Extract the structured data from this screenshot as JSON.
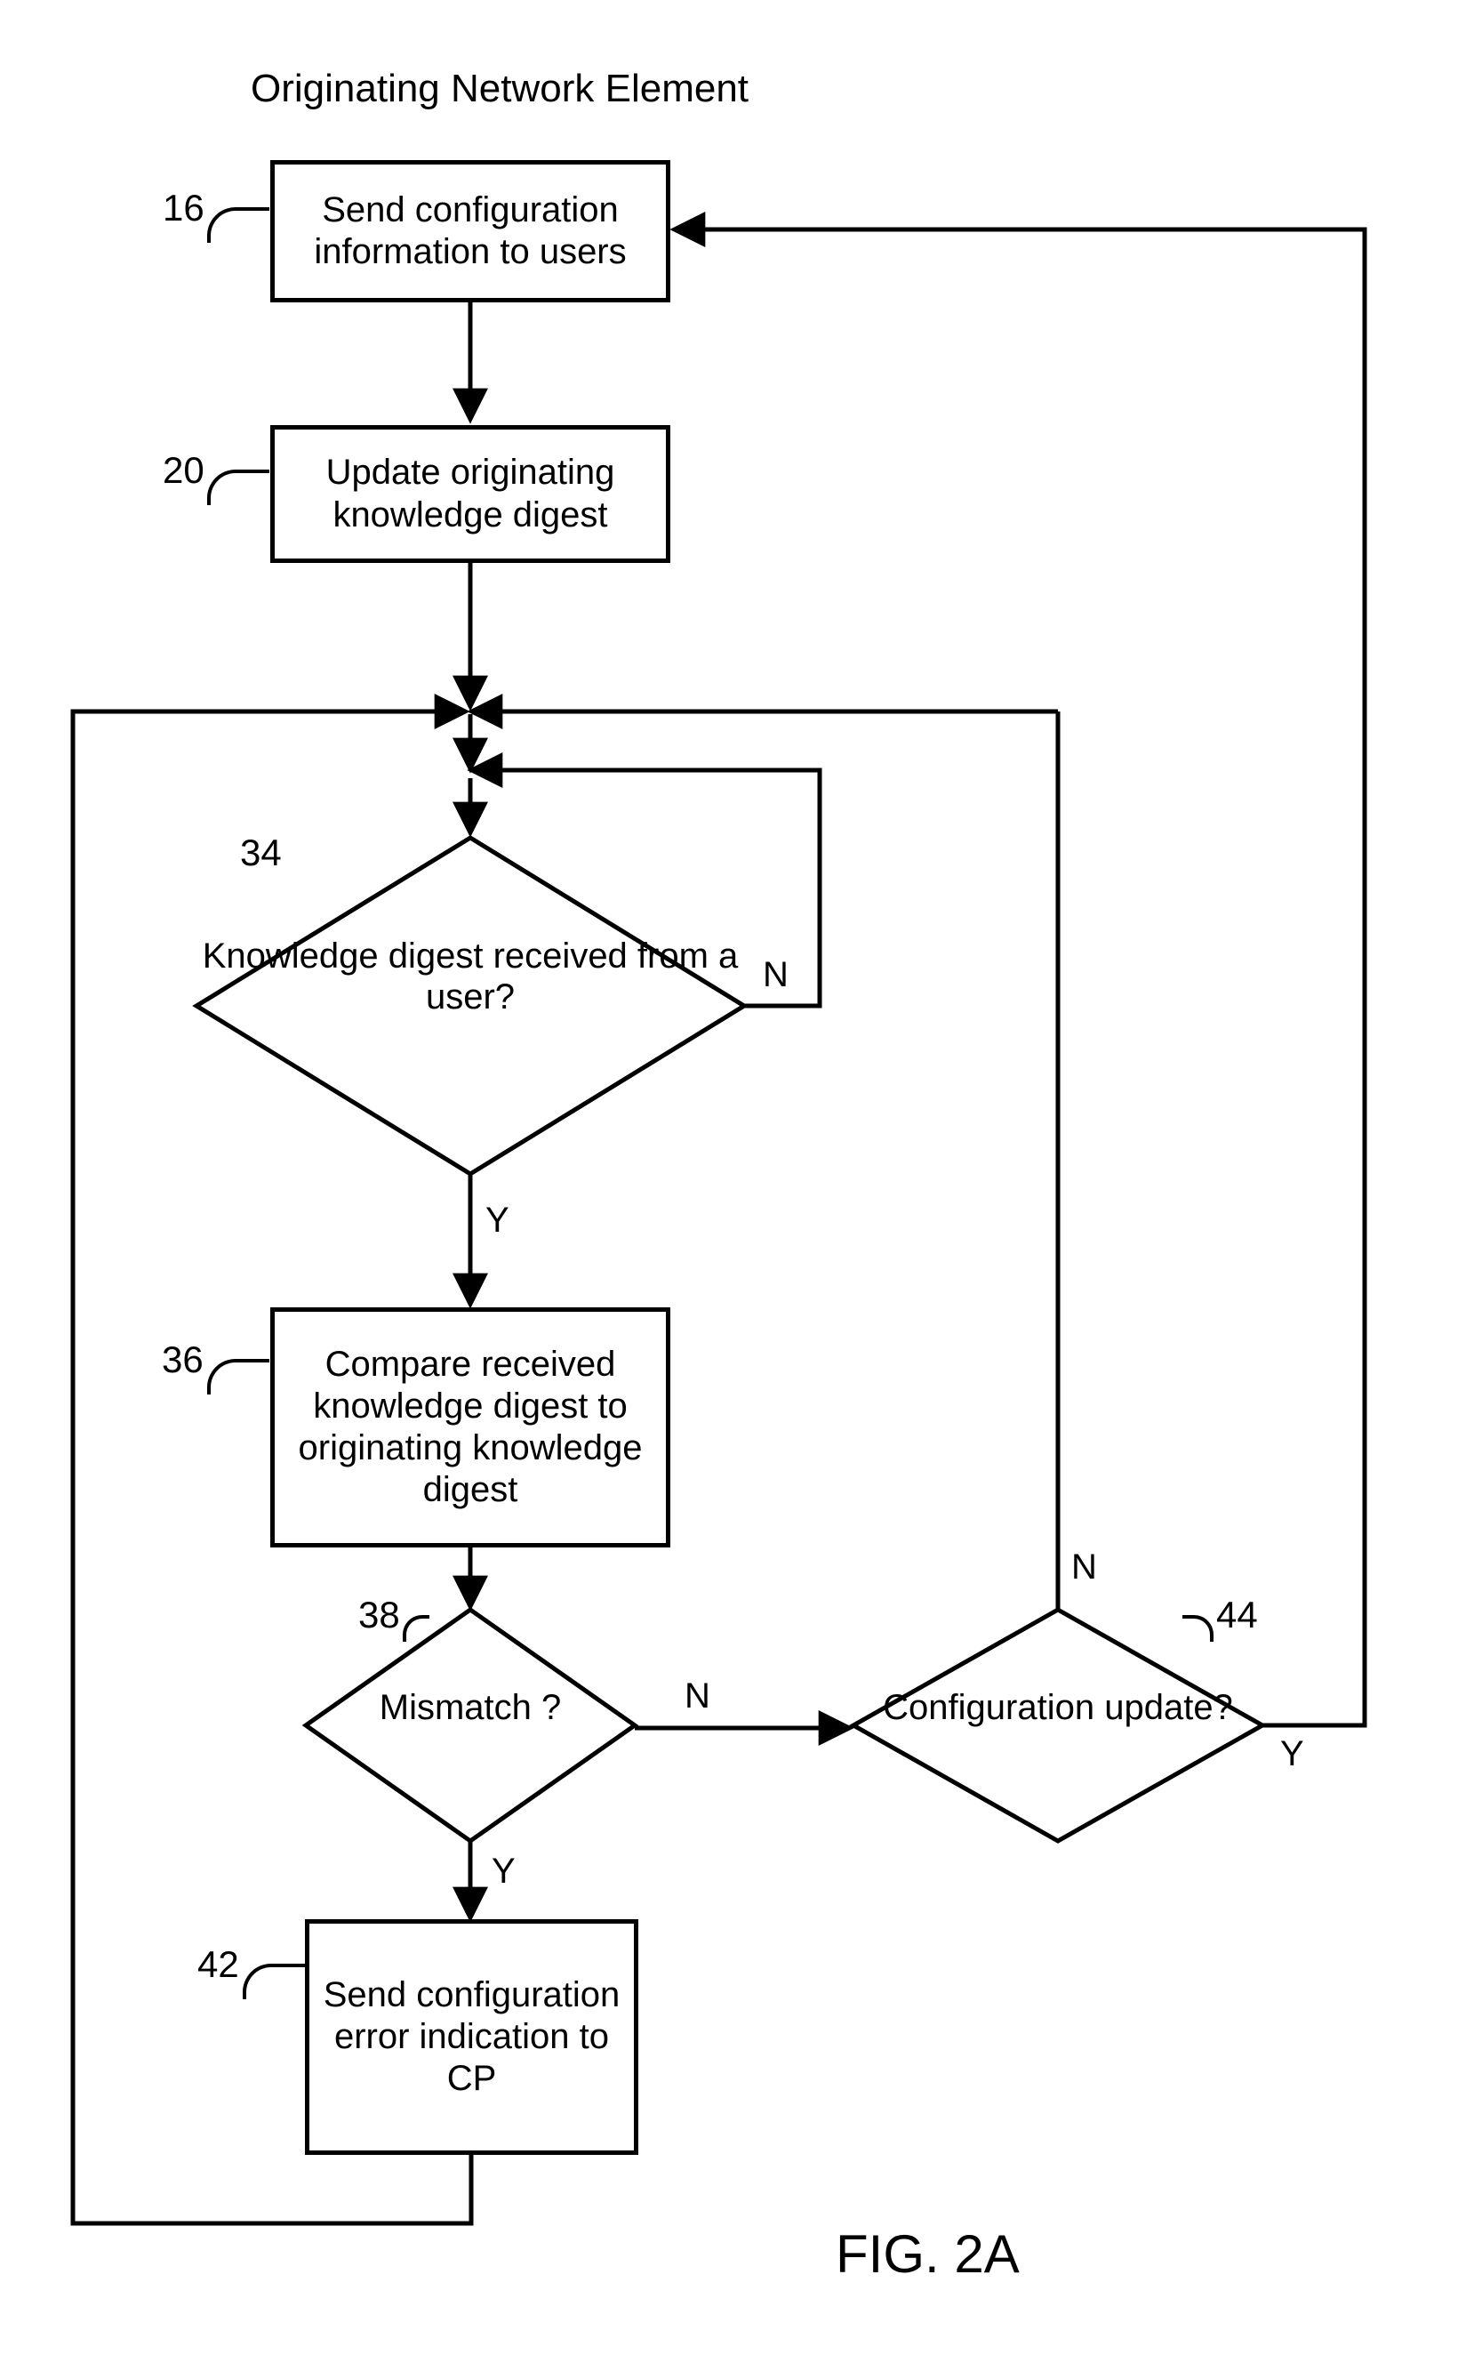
{
  "title": "Originating Network Element",
  "figure": "FIG. 2A",
  "refs": {
    "r16": "16",
    "r20": "20",
    "r34": "34",
    "r36": "36",
    "r38": "38",
    "r42": "42",
    "r44": "44"
  },
  "boxes": {
    "b16": "Send configuration information to users",
    "b20": "Update originating knowledge digest",
    "b36": "Compare received knowledge digest to originating knowledge digest",
    "b42": "Send configuration error indication to CP"
  },
  "decisions": {
    "d34": "Knowledge digest received from a user?",
    "d38": "Mismatch ?",
    "d44": "Configuration update?"
  },
  "labels": {
    "Y": "Y",
    "N": "N"
  }
}
